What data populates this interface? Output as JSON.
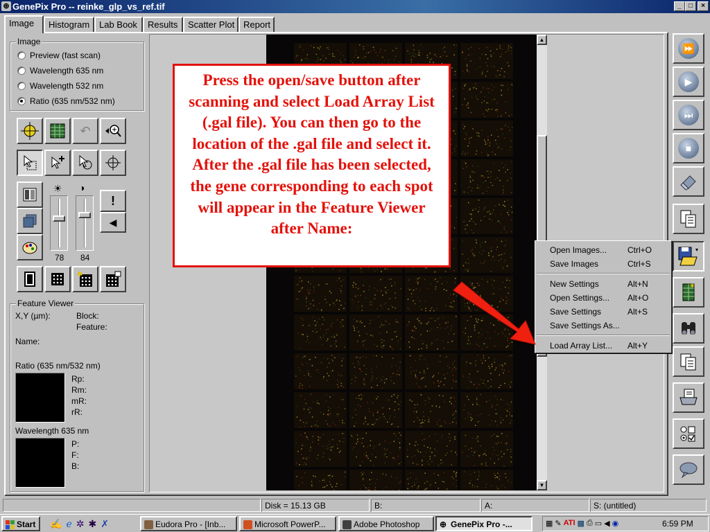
{
  "window": {
    "title": "GenePix Pro -- reinke_glp_vs_ref.tif",
    "controls": [
      "_",
      "□",
      "×"
    ]
  },
  "tabs": [
    {
      "label": "Image",
      "active": true
    },
    {
      "label": "Histogram"
    },
    {
      "label": "Lab Book"
    },
    {
      "label": "Results"
    },
    {
      "label": "Scatter Plot"
    },
    {
      "label": "Report"
    }
  ],
  "image_group": {
    "title": "Image",
    "options": [
      {
        "label": "Preview  (fast scan)",
        "selected": false
      },
      {
        "label": "Wavelength 635 nm",
        "selected": false
      },
      {
        "label": "Wavelength 532 nm",
        "selected": false
      },
      {
        "label": "Ratio (635 nm/532 nm)",
        "selected": true
      }
    ]
  },
  "sliders": {
    "brightness_value": "78",
    "contrast_value": "84",
    "brightness_level": 0.62,
    "contrast_level": 0.7
  },
  "feature_viewer": {
    "title": "Feature Viewer",
    "xy_label": "X,Y (µm):",
    "block_label": "Block:",
    "feature_label": "Feature:",
    "name_label": "Name:",
    "ratio_title": "Ratio (635 nm/532 nm)",
    "ratio_fields": [
      "Rp:",
      "Rm:",
      "mR:",
      "rR:"
    ],
    "wavelength_title": "Wavelength 635 nm",
    "wavelength_fields": [
      "P:",
      "F:",
      "B:"
    ]
  },
  "annotation": {
    "text": "Press the open/save button after scanning and select Load Array List (.gal file).   You can then go to the location of the .gal file and select it.  After the .gal file has been selected, the gene corresponding to each spot will appear in the Feature Viewer after Name:",
    "color": "#e3120b"
  },
  "context_menu": {
    "items": [
      {
        "label": "Open Images...",
        "shortcut": "Ctrl+O"
      },
      {
        "label": "Save Images",
        "shortcut": "Ctrl+S"
      },
      {
        "label": "New Settings",
        "shortcut": "Alt+N"
      },
      {
        "label": "Open Settings...",
        "shortcut": "Alt+O"
      },
      {
        "label": "Save Settings",
        "shortcut": "Alt+S"
      },
      {
        "label": "Save Settings As...",
        "shortcut": ""
      },
      {
        "label": "Load Array List...",
        "shortcut": "Alt+Y"
      }
    ]
  },
  "status_bar": {
    "disk": "Disk = 15.13 GB",
    "b": "B:",
    "a": "A:",
    "s": "S: (untitled)"
  },
  "taskbar": {
    "start_label": "Start",
    "tasks": [
      {
        "label": "Eudora Pro - [Inb...",
        "icon": "eudora-icon"
      },
      {
        "label": "Microsoft PowerP...",
        "icon": "powerpoint-icon"
      },
      {
        "label": "Adobe Photoshop",
        "icon": "photoshop-icon"
      },
      {
        "label": "GenePix Pro -...",
        "icon": "genepix-icon",
        "active": true
      }
    ],
    "clock": "6:59 PM"
  },
  "colors": {
    "accent_red": "#e3120b",
    "title_blue": "#0a246a",
    "microarray_bg": "#080606"
  }
}
